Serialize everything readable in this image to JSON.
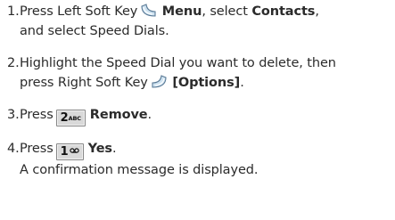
{
  "steps": [
    {
      "number": "1.",
      "parts": {
        "text_1": "Press Left Soft Key",
        "bold_1": "Menu",
        "text_2": ", select",
        "bold_2": "Contacts",
        "text_3": ",",
        "text_4": "and select Speed Dials."
      }
    },
    {
      "number": "2.",
      "parts": {
        "text_1": "Highlight the Speed Dial you want to delete, then",
        "text_2": "press Right Soft Key",
        "bold_1": "[Options]",
        "text_3": "."
      }
    },
    {
      "number": "3.",
      "parts": {
        "text_1": "Press",
        "key_main": "2",
        "key_sub": "ABC",
        "bold_1": "Remove",
        "text_2": "."
      }
    },
    {
      "number": "4.",
      "parts": {
        "text_1": "Press",
        "key_main": "1",
        "bold_1": "Yes",
        "text_2": ".",
        "note": "A confirmation message is displayed."
      }
    }
  ],
  "icons": {
    "left_soft_key": "left-soft-key-icon",
    "right_soft_key": "right-soft-key-icon",
    "voicemail": "voicemail-icon"
  },
  "colors": {
    "text": "#2b2b2b",
    "soft_key_fill": "#cfe3f1",
    "soft_key_stroke": "#5a7a96",
    "key_fill": "#d9d9d9"
  }
}
